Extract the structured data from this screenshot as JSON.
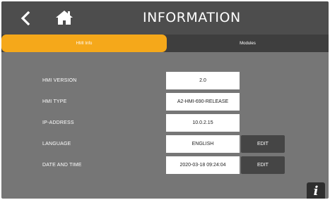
{
  "header": {
    "title": "INFORMATION",
    "back_icon": "chevron-left-icon",
    "home_icon": "home-icon"
  },
  "tabs": [
    {
      "label": "HMI Info",
      "active": true
    },
    {
      "label": "Modules",
      "active": false
    }
  ],
  "rows": [
    {
      "label": "HMI VERSION",
      "value": "2.0"
    },
    {
      "label": "HMI TYPE",
      "value": "A2-HMI-690-RELEASE"
    },
    {
      "label": "IP-ADDRESS",
      "value": "10.0.2.15"
    },
    {
      "label": "LANGUAGE",
      "value": "ENGLISH",
      "action": "EDIT"
    },
    {
      "label": "DATE AND TIME",
      "value": "2020-03-18 09:24:04",
      "action": "EDIT"
    }
  ],
  "info_button": {
    "glyph": "i",
    "icon": "info-icon"
  },
  "colors": {
    "accent": "#f5a81a",
    "header_bg": "#4d4d4d",
    "body_bg": "#767676",
    "tab_bar_bg": "#3e3e3e",
    "button_bg": "#454545"
  }
}
